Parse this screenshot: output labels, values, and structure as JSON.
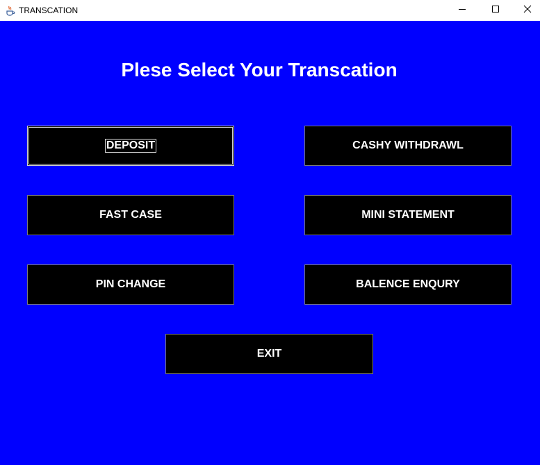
{
  "window": {
    "title": "TRANSCATION",
    "icon": "java-cup-icon",
    "controls": {
      "minimize": "minimize-icon",
      "maximize": "maximize-icon",
      "close": "close-icon"
    }
  },
  "main": {
    "heading": "Plese Select Your Transcation",
    "background_color": "#0000ff",
    "buttons": {
      "deposit": "DEPOSIT",
      "cash_withdrawl": "CASHY WITHDRAWL",
      "fast_cash": "FAST CASE",
      "mini_statement": "MINI STATEMENT",
      "pin_change": "PIN CHANGE",
      "balance_enquiry": "BALENCE ENQURY",
      "exit": "EXIT"
    },
    "button_color": "#000000",
    "text_color": "#ffffff"
  }
}
